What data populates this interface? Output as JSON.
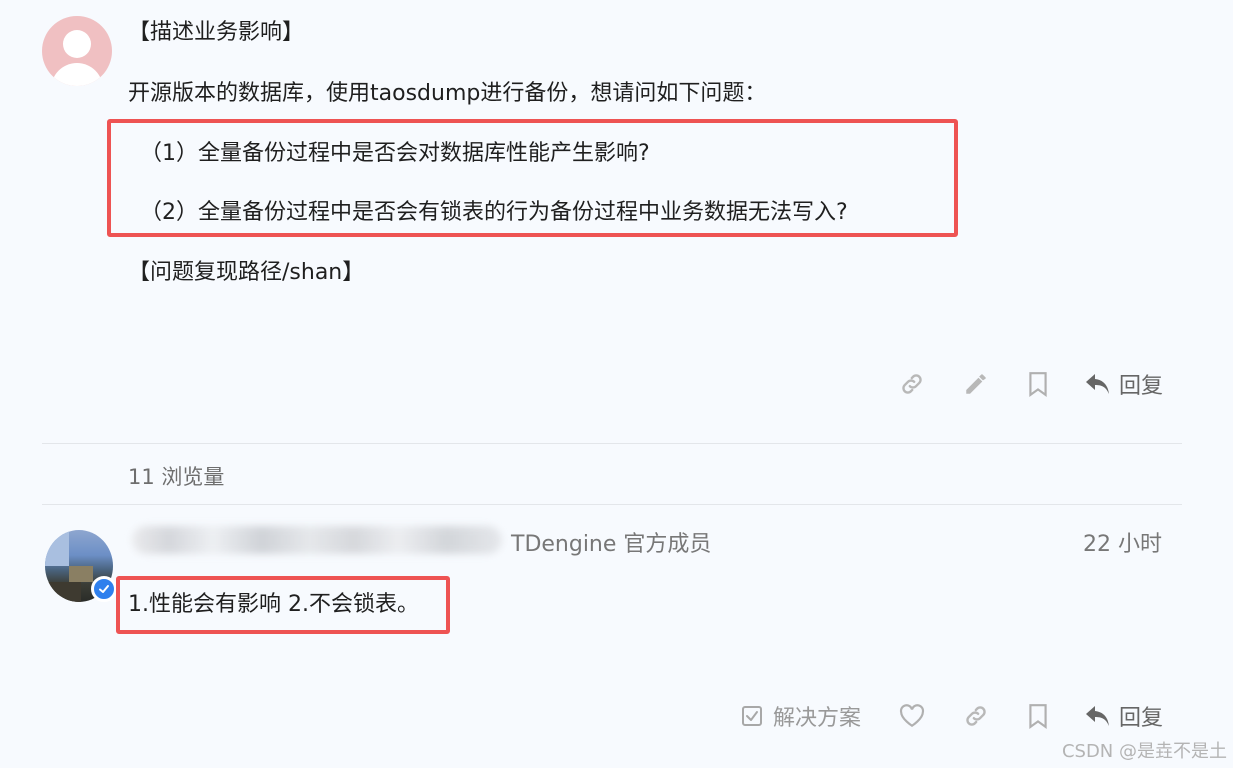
{
  "post1": {
    "lines": [
      "【描述业务影响】",
      "开源版本的数据库，使用taosdump进行备份，想请问如下问题：",
      "（1）全量备份过程中是否会对数据库性能产生影响?",
      "（2）全量备份过程中是否会有锁表的行为备份过程中业务数据无法写入?",
      "【问题复现路径/shan】"
    ],
    "reply_label": "回复"
  },
  "views_text": "11 浏览量",
  "post2": {
    "member_tag": "TDengine 官方成员",
    "time": "22 小时",
    "answer": "1.性能会有影响 2.不会锁表。",
    "solution_label": "解决方案",
    "reply_label": "回复"
  },
  "watermark": "CSDN @是垚不是土",
  "colors": {
    "highlight_border": "#ee5353",
    "background": "#f7fafe",
    "verified_badge": "#2f80ed"
  },
  "icons": [
    "link-icon",
    "pencil-icon",
    "bookmark-icon",
    "reply-icon",
    "checkbox-icon",
    "heart-icon",
    "verified-icon"
  ]
}
